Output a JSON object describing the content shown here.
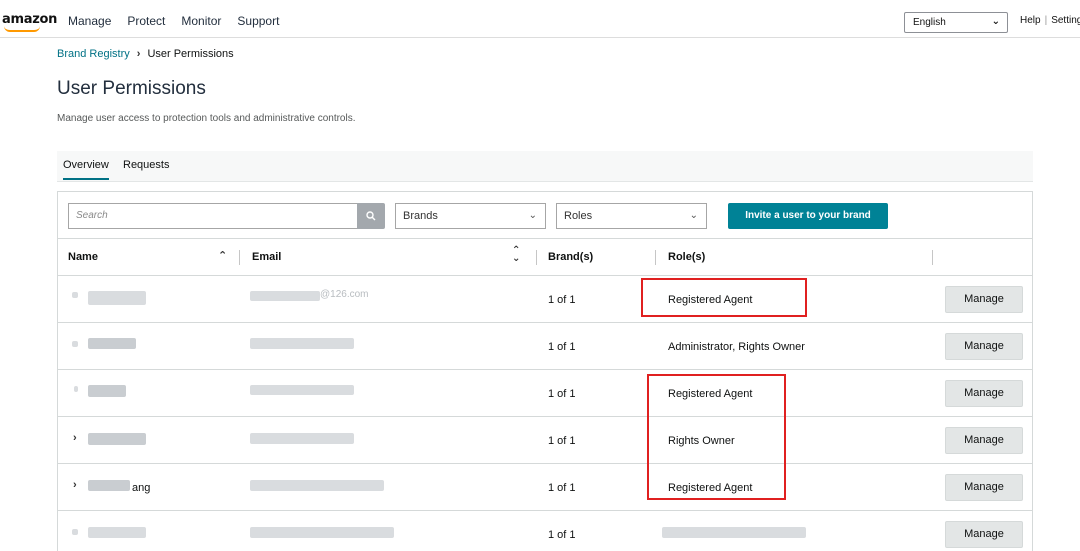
{
  "nav": {
    "logo": "amazon",
    "links": [
      "Manage",
      "Protect",
      "Monitor",
      "Support"
    ],
    "language": "English",
    "help": "Help",
    "settings": "Settings"
  },
  "breadcrumb": {
    "root": "Brand Registry",
    "current": "User Permissions"
  },
  "page": {
    "title": "User Permissions",
    "subtitle": "Manage user access to protection tools and administrative controls."
  },
  "tabs": [
    "Overview",
    "Requests"
  ],
  "filters": {
    "search_placeholder": "Search",
    "brands": "Brands",
    "roles": "Roles",
    "invite_label": "Invite a user to your brand"
  },
  "table": {
    "headers": {
      "name": "Name",
      "email": "Email",
      "brands": "Brand(s)",
      "roles": "Role(s)"
    },
    "rows": [
      {
        "brands": "1 of 1",
        "role": "Registered Agent",
        "name_suffix": "",
        "email_suffix": "@126.com",
        "action": "Manage"
      },
      {
        "brands": "1 of 1",
        "role": "Administrator, Rights Owner",
        "name_suffix": "",
        "email_suffix": "",
        "action": "Manage"
      },
      {
        "brands": "1 of 1",
        "role": "Registered Agent",
        "name_suffix": "",
        "email_suffix": "",
        "action": "Manage"
      },
      {
        "brands": "1 of 1",
        "role": "Rights Owner",
        "name_suffix": "",
        "email_suffix": "",
        "action": "Manage"
      },
      {
        "brands": "1 of 1",
        "role": "Registered Agent",
        "name_suffix": "ang",
        "email_suffix": "",
        "action": "Manage"
      },
      {
        "brands": "1 of 1",
        "role": "",
        "name_suffix": "",
        "email_suffix": "",
        "action": "Manage"
      }
    ]
  },
  "colors": {
    "accent": "#008296",
    "link": "#007185",
    "highlight": "#e02020",
    "logo_smile": "#ff9900"
  }
}
